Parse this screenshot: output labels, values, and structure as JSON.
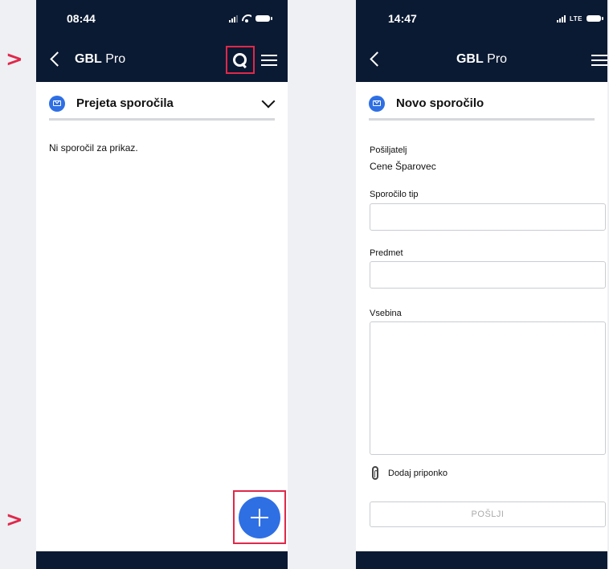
{
  "markers": {
    "arrow": ">"
  },
  "left_screen": {
    "status": {
      "time": "08:44"
    },
    "nav": {
      "title_bold": "GBL",
      "title_rest": " Pro"
    },
    "section": {
      "title": "Prejeta sporočila"
    },
    "empty_message": "Ni sporočil za prikaz."
  },
  "right_screen": {
    "status": {
      "time": "14:47",
      "network": "LTE"
    },
    "nav": {
      "title_bold": "GBL",
      "title_rest": " Pro"
    },
    "section": {
      "title": "Novo sporočilo"
    },
    "form": {
      "sender_label": "Pošiljatelj",
      "sender_value": "Cene Šparovec",
      "type_label": "Sporočilo tip",
      "type_value": "",
      "subject_label": "Predmet",
      "subject_value": "",
      "content_label": "Vsebina",
      "content_value": "",
      "attach_label": "Dodaj priponko",
      "send_label": "POŠLJI"
    }
  },
  "colors": {
    "nav_bg": "#0b1a33",
    "accent": "#2f6fe4",
    "highlight": "#e0284a",
    "page_bg": "#eef0f4"
  }
}
